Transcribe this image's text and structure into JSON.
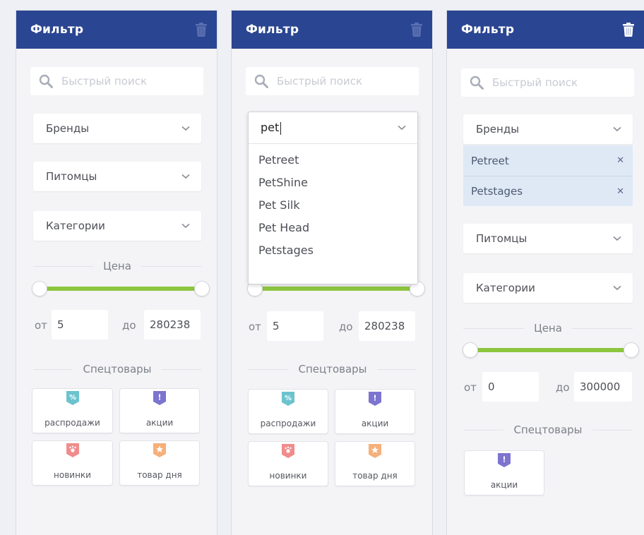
{
  "colors": {
    "header_bg": "#2a4592",
    "slider_fill": "#8cc63f",
    "badge_sale": "#6cc3cd",
    "badge_promo": "#7d74cf",
    "badge_new": "#f08c8c",
    "badge_deal": "#f6b07a",
    "selected_bg": "#dfe9f6"
  },
  "panels": [
    {
      "title": "Фильтр",
      "trash_icon": "trash-icon",
      "search_placeholder": "Быстрый поиск",
      "dropdowns": [
        "Бренды",
        "Питомцы",
        "Категории"
      ],
      "price_title": "Цена",
      "from_label": "от",
      "to_label": "до",
      "price_from": "5",
      "price_to": "280238",
      "specials_title": "Спецтовары",
      "specials": [
        {
          "label": "распродажи",
          "icon": "percent-badge-icon"
        },
        {
          "label": "акции",
          "icon": "exclamation-badge-icon"
        },
        {
          "label": "новинки",
          "icon": "paw-badge-icon"
        },
        {
          "label": "товар дня",
          "icon": "star-badge-icon"
        }
      ]
    },
    {
      "title": "Фильтр",
      "trash_icon": "trash-icon",
      "search_placeholder": "Быстрый поиск",
      "brand_query": "pet",
      "brand_options": [
        "Petreet",
        "PetShine",
        "Pet Silk",
        "Pet Head",
        "Petstages"
      ],
      "from_label": "от",
      "to_label": "до",
      "price_from": "5",
      "price_to": "280238",
      "specials_title": "Спецтовары",
      "specials": [
        {
          "label": "распродажи",
          "icon": "percent-badge-icon"
        },
        {
          "label": "акции",
          "icon": "exclamation-badge-icon"
        },
        {
          "label": "новинки",
          "icon": "paw-badge-icon"
        },
        {
          "label": "товар дня",
          "icon": "star-badge-icon"
        }
      ]
    },
    {
      "title": "Фильтр",
      "trash_icon": "trash-icon",
      "search_placeholder": "Быстрый поиск",
      "dropdowns": [
        "Бренды",
        "Питомцы",
        "Категории"
      ],
      "selected_brands": [
        "Petreet",
        "Petstages"
      ],
      "price_title": "Цена",
      "from_label": "от",
      "to_label": "до",
      "price_from": "0",
      "price_to": "300000",
      "specials_title": "Спецтовары",
      "specials": [
        {
          "label": "акции",
          "icon": "exclamation-badge-icon"
        }
      ]
    }
  ]
}
